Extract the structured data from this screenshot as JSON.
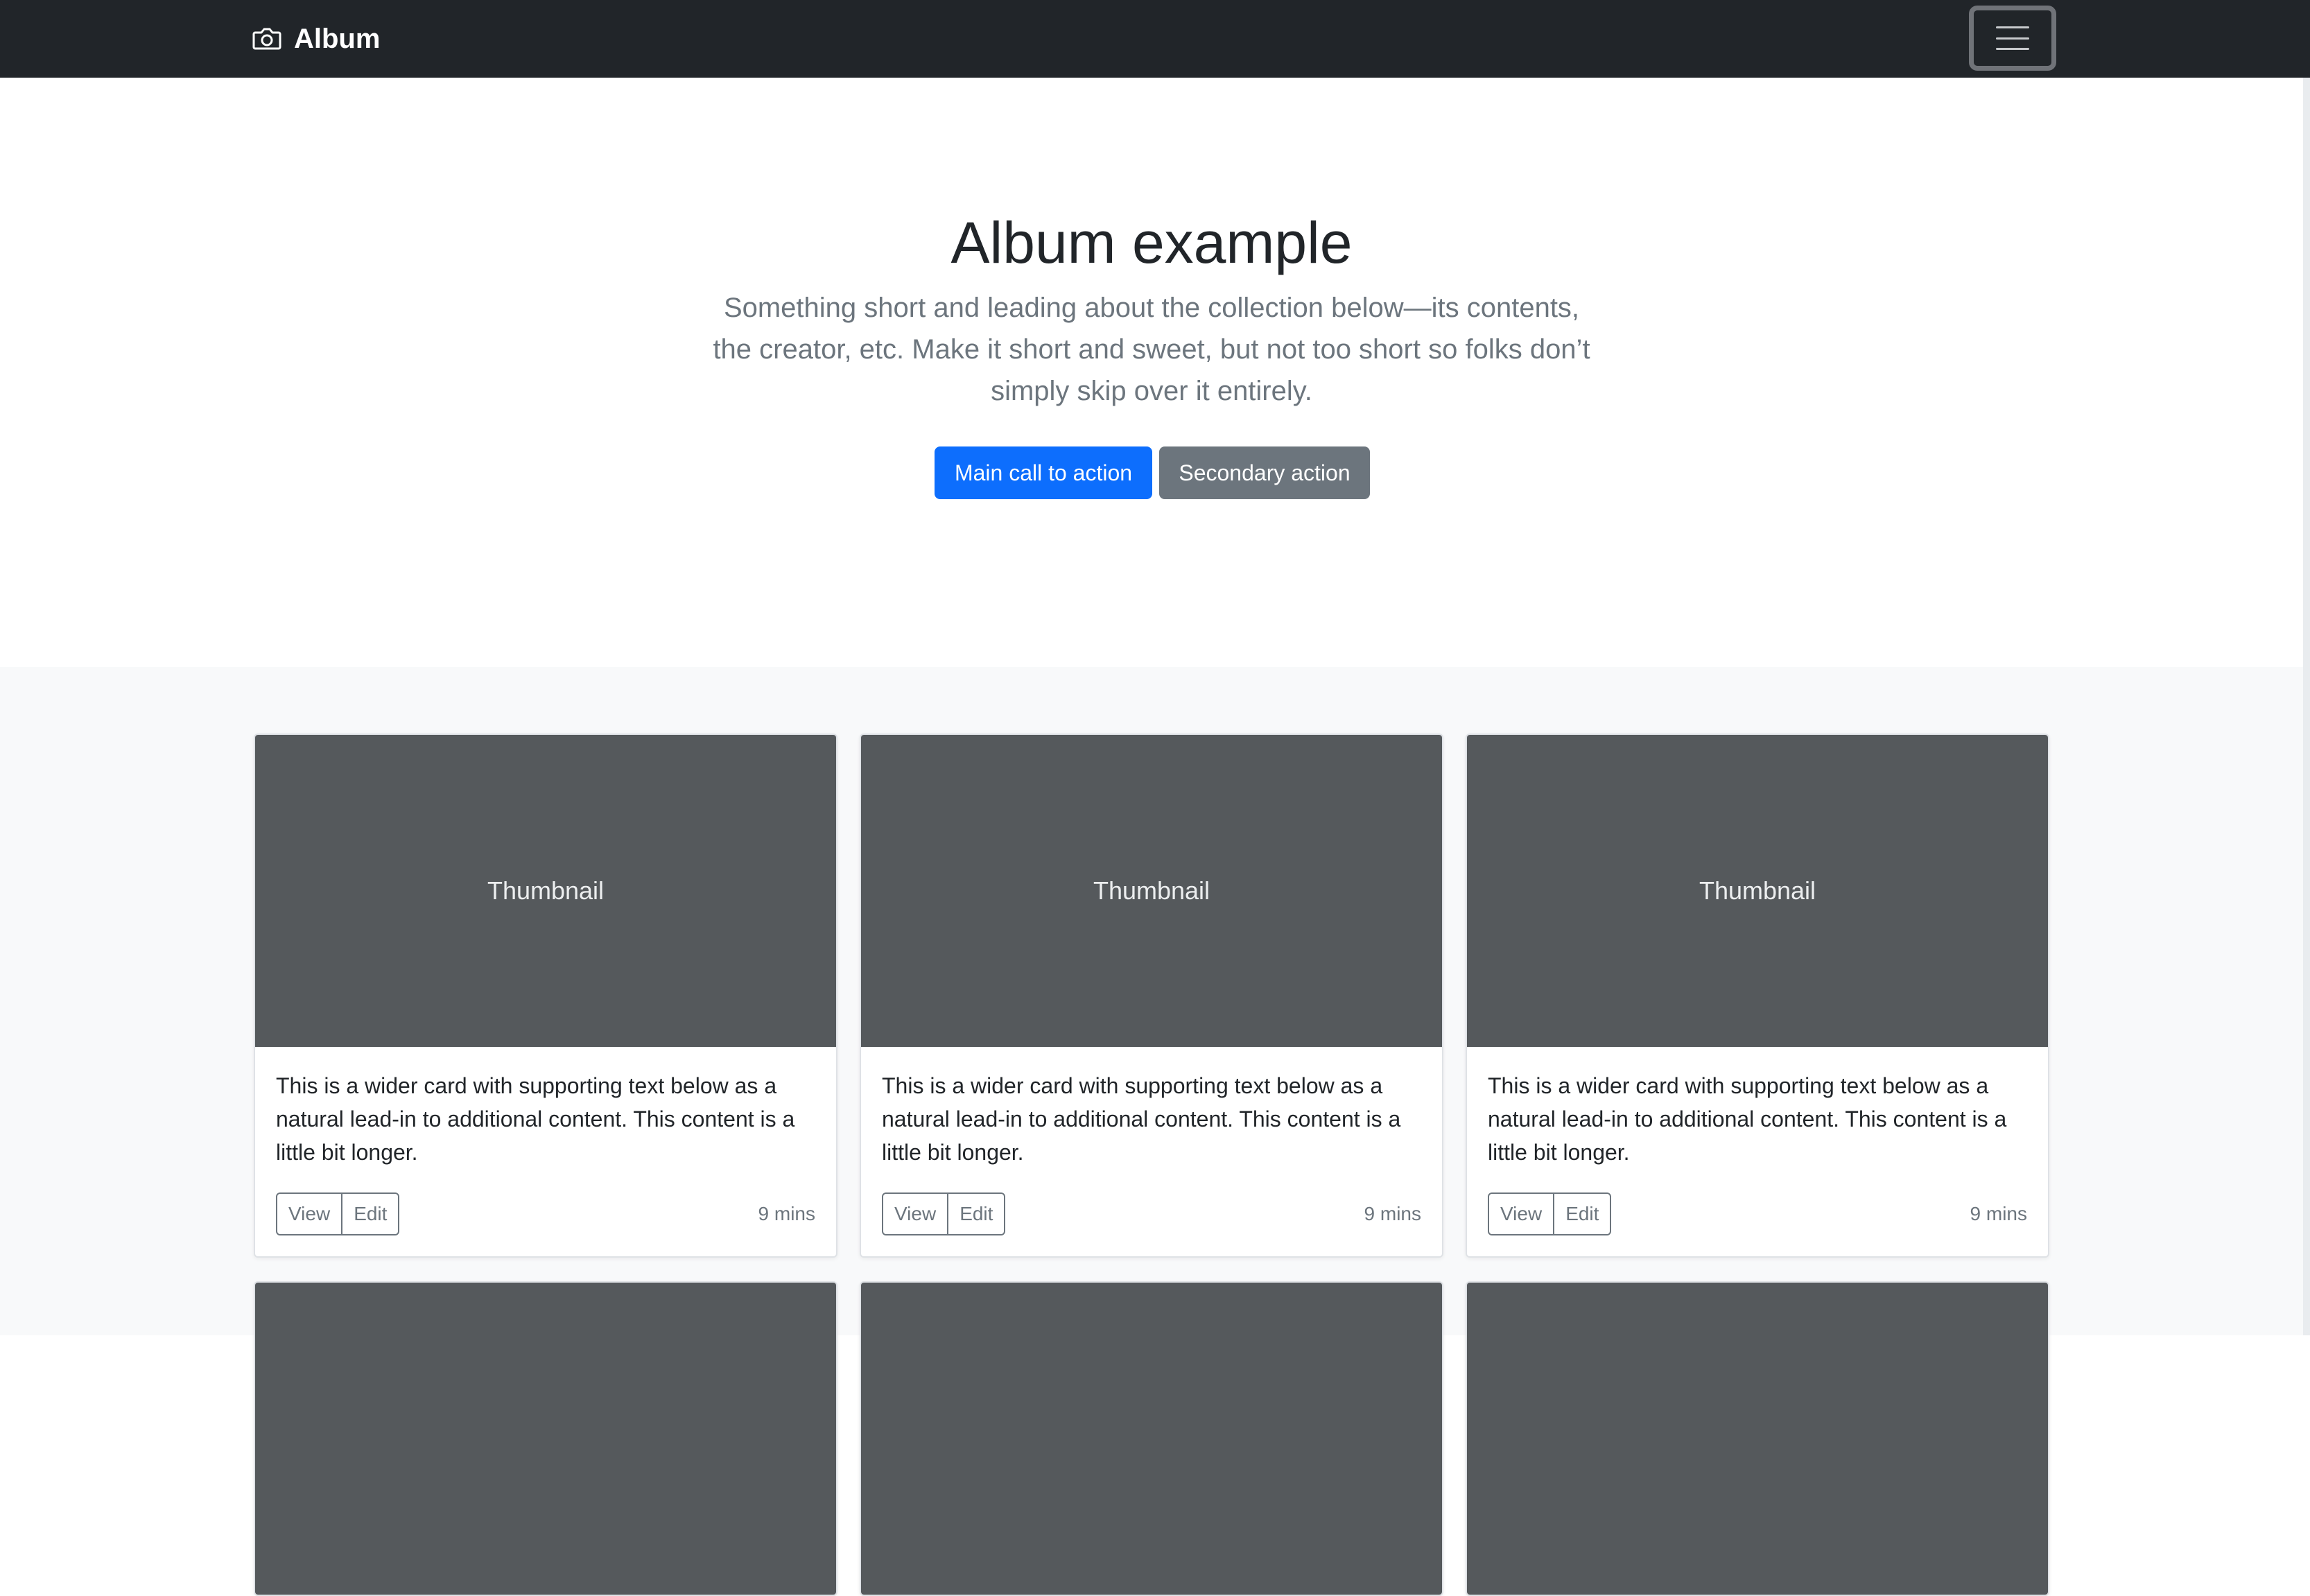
{
  "navbar": {
    "brand": "Album",
    "brand_icon": "camera-icon",
    "toggler_icon": "hamburger-icon"
  },
  "hero": {
    "title": "Album example",
    "lead": "Something short and leading about the collection below—its contents, the creator, etc. Make it short and sweet, but not too short so folks don’t simply skip over it entirely.",
    "primary_button": "Main call to action",
    "secondary_button": "Secondary action"
  },
  "cards": [
    {
      "thumbnail": "Thumbnail",
      "text": "This is a wider card with supporting text below as a natural lead-in to additional content. This content is a little bit longer.",
      "view": "View",
      "edit": "Edit",
      "time": "9 mins"
    },
    {
      "thumbnail": "Thumbnail",
      "text": "This is a wider card with supporting text below as a natural lead-in to additional content. This content is a little bit longer.",
      "view": "View",
      "edit": "Edit",
      "time": "9 mins"
    },
    {
      "thumbnail": "Thumbnail",
      "text": "This is a wider card with supporting text below as a natural lead-in to additional content. This content is a little bit longer.",
      "view": "View",
      "edit": "Edit",
      "time": "9 mins"
    },
    {
      "thumbnail": "",
      "text": "",
      "view": "",
      "edit": "",
      "time": ""
    },
    {
      "thumbnail": "",
      "text": "",
      "view": "",
      "edit": "",
      "time": ""
    },
    {
      "thumbnail": "",
      "text": "",
      "view": "",
      "edit": "",
      "time": ""
    }
  ],
  "colors": {
    "navbar_bg": "#212529",
    "primary": "#0d6efd",
    "secondary": "#6c757d",
    "thumbnail_bg": "#55595c",
    "album_bg": "#f8f9fa"
  }
}
